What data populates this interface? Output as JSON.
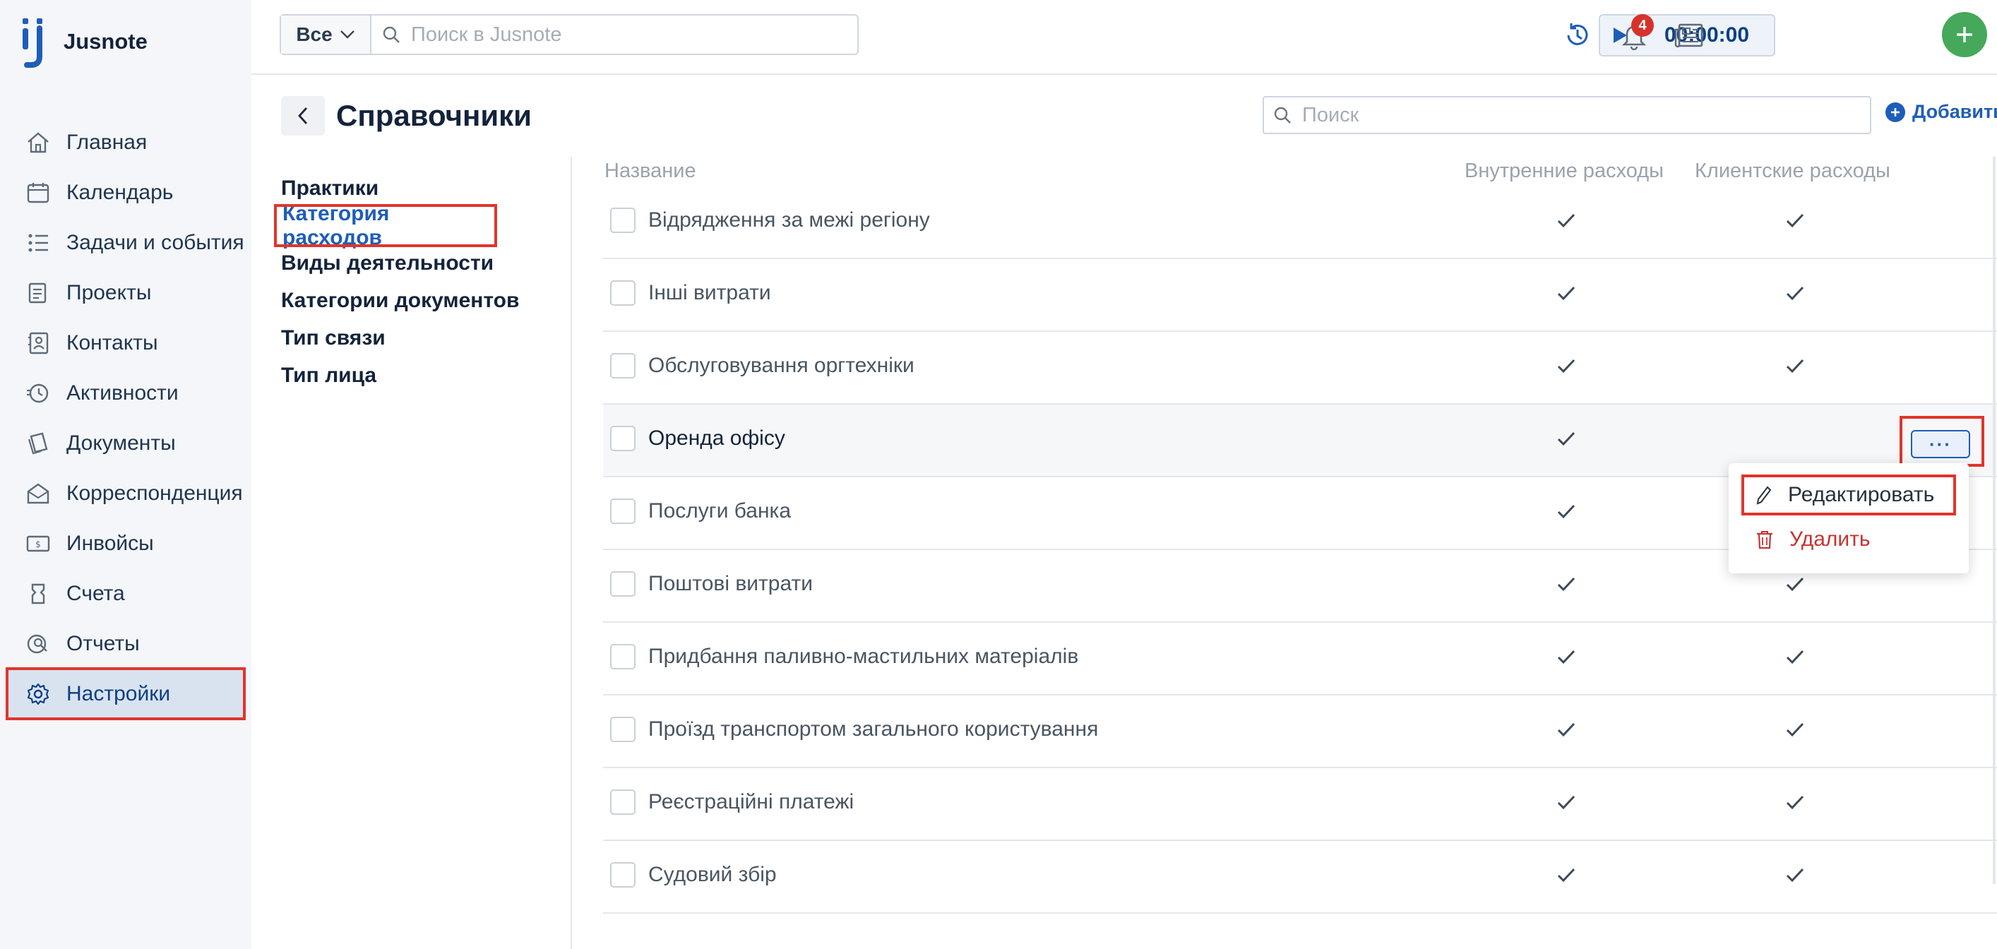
{
  "app": {
    "name": "Jusnote"
  },
  "sidebar": {
    "items": [
      {
        "label": "Главная",
        "icon": "home-icon"
      },
      {
        "label": "Календарь",
        "icon": "calendar-icon"
      },
      {
        "label": "Задачи и события",
        "icon": "tasks-icon"
      },
      {
        "label": "Проекты",
        "icon": "projects-icon"
      },
      {
        "label": "Контакты",
        "icon": "contacts-icon"
      },
      {
        "label": "Активности",
        "icon": "activity-icon"
      },
      {
        "label": "Документы",
        "icon": "documents-icon"
      },
      {
        "label": "Корреспонденция",
        "icon": "correspondence-icon"
      },
      {
        "label": "Инвойсы",
        "icon": "invoice-icon"
      },
      {
        "label": "Счета",
        "icon": "accounts-icon"
      },
      {
        "label": "Отчеты",
        "icon": "reports-icon"
      },
      {
        "label": "Настройки",
        "icon": "gear-icon",
        "active": true
      }
    ]
  },
  "topbar": {
    "scope": "Все",
    "search_placeholder": "Поиск в Jusnote",
    "timer": "00:00:00",
    "notifications_count": "4"
  },
  "page": {
    "title": "Справочники",
    "search_placeholder": "Поиск",
    "add_label": "Добавить"
  },
  "submenu": [
    {
      "label": "Практики"
    },
    {
      "label": "Категория расходов",
      "active": true
    },
    {
      "label": "Виды деятельности"
    },
    {
      "label": "Категории документов"
    },
    {
      "label": "Тип связи"
    },
    {
      "label": "Тип лица"
    }
  ],
  "table": {
    "columns": [
      "Название",
      "Внутренние расходы",
      "Клиентские расходы"
    ],
    "rows": [
      {
        "name": "Відрядження за межі регіону",
        "internal": true,
        "client": true
      },
      {
        "name": "Інші витрати",
        "internal": true,
        "client": true
      },
      {
        "name": "Обслуговування оргтехніки",
        "internal": true,
        "client": true
      },
      {
        "name": "Оренда офісу",
        "internal": true,
        "client": false,
        "hover": true
      },
      {
        "name": "Послуги банка",
        "internal": true,
        "client": true
      },
      {
        "name": "Поштові витрати",
        "internal": true,
        "client": true
      },
      {
        "name": "Придбання паливно-мастильних матеріалів",
        "internal": true,
        "client": true
      },
      {
        "name": "Проїзд транспортом загального користування",
        "internal": true,
        "client": true
      },
      {
        "name": "Реєстраційні платежі",
        "internal": true,
        "client": true
      },
      {
        "name": "Судовий збір",
        "internal": true,
        "client": true
      }
    ],
    "more_label": "···"
  },
  "context_menu": {
    "edit": "Редактировать",
    "delete": "Удалить"
  },
  "colors": {
    "accent": "#1e5db9",
    "highlight": "#e0352b",
    "danger": "#c43531",
    "success": "#45a85a"
  }
}
